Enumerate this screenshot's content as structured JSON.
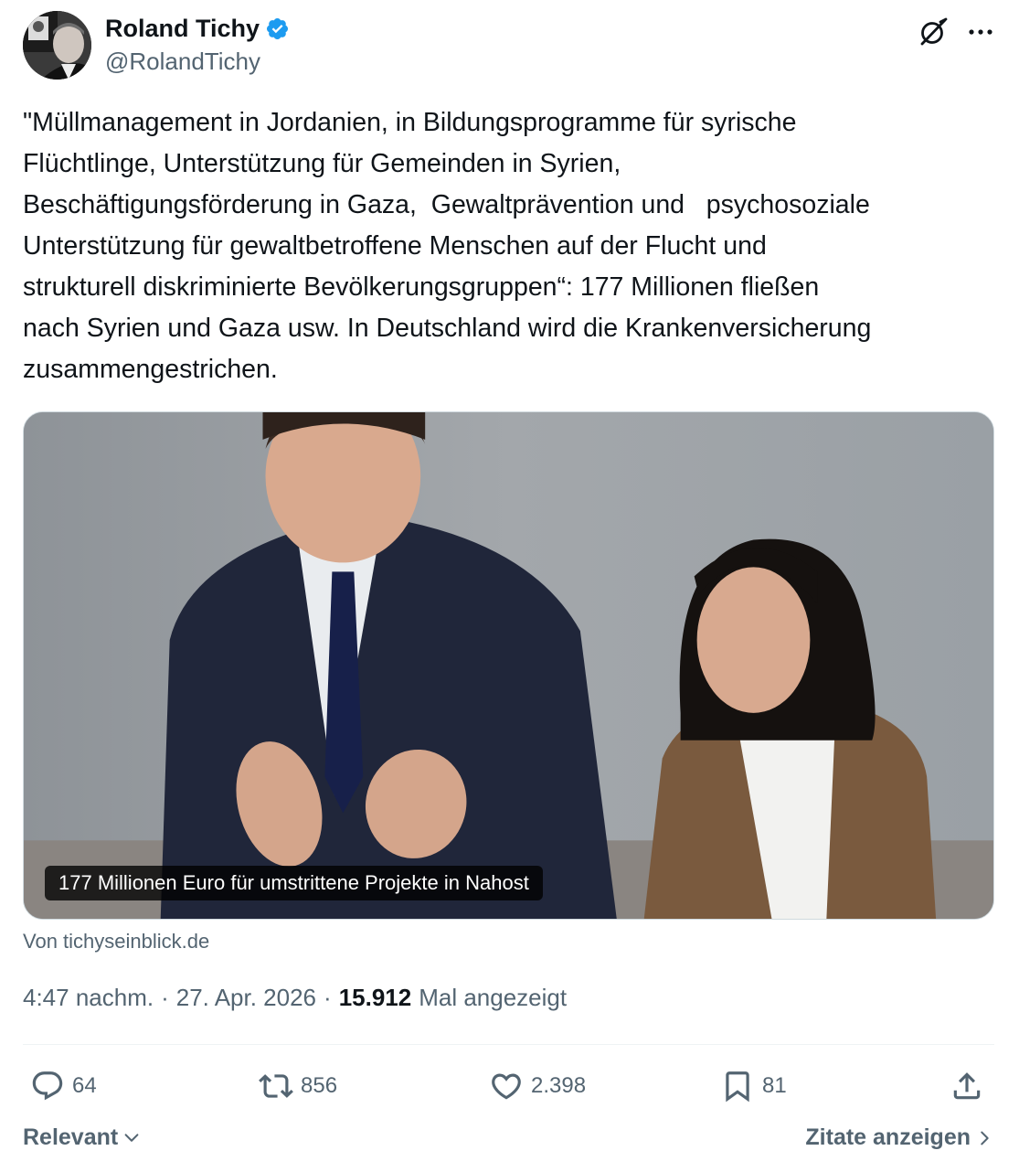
{
  "author": {
    "name": "Roland Tichy",
    "handle": "@RolandTichy"
  },
  "tweet": {
    "text": "\"Müllmanagement in Jordanien, in Bildungsprogramme für syrische\nFlüchtlinge, Unterstützung für Gemeinden in Syrien,\nBeschäftigungsförderung in Gaza,  Gewaltprävention und   psychosoziale\nUnterstützung für gewaltbetroffene Menschen auf der Flucht und\nstrukturell diskriminierte Bevölkerungsgruppen“: 177 Millionen fließen\nnach Syrien und Gaza usw. In Deutschland wird die Krankenversicherung\nzusammengestrichen."
  },
  "card": {
    "caption": "177 Millionen Euro für umstrittene Projekte in Nahost",
    "source": "Von tichyseinblick.de"
  },
  "meta": {
    "time": "4:47 nachm.",
    "separator": "·",
    "date": "27. Apr. 2026",
    "views_count": "15.912",
    "views_label": "Mal angezeigt"
  },
  "actions": {
    "replies": "64",
    "reposts": "856",
    "likes": "2.398",
    "bookmarks": "81"
  },
  "footer": {
    "sort_label": "Relevant",
    "quotes_label": "Zitate anzeigen"
  },
  "colors": {
    "text_primary": "#0f1419",
    "text_secondary": "#536471",
    "verified_blue": "#1d9bf0",
    "divider": "#eff3f4"
  }
}
